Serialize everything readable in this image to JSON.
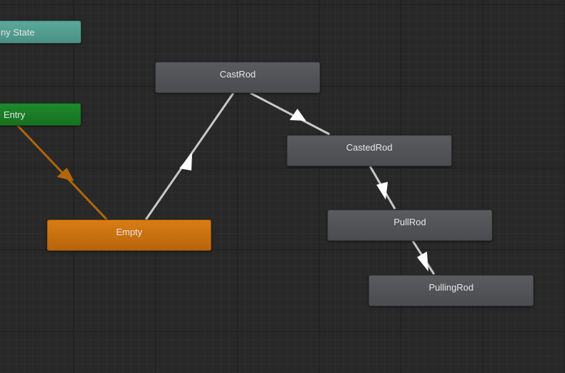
{
  "graph": {
    "background_color": "#282828",
    "states": {
      "any_state": {
        "label": "ny State",
        "color": "#5ba89a"
      },
      "entry": {
        "label": "Entry",
        "color": "#1e8a2e"
      },
      "empty": {
        "label": "Empty",
        "color": "#d97d14",
        "is_default": true
      },
      "cast_rod": {
        "label": "CastRod",
        "color": "#55565a"
      },
      "casted_rod": {
        "label": "CastedRod",
        "color": "#55565a"
      },
      "pull_rod": {
        "label": "PullRod",
        "color": "#55565a"
      },
      "pulling_rod": {
        "label": "PullingRod",
        "color": "#55565a"
      }
    },
    "transitions": [
      {
        "from": "Entry",
        "to": "Empty",
        "color": "#b0670a"
      },
      {
        "from": "Empty",
        "to": "CastRod",
        "color": "#c8c8c8"
      },
      {
        "from": "CastRod",
        "to": "CastedRod",
        "color": "#c8c8c8"
      },
      {
        "from": "CastedRod",
        "to": "PullRod",
        "color": "#c8c8c8"
      },
      {
        "from": "PullRod",
        "to": "PullingRod",
        "color": "#c8c8c8"
      }
    ]
  }
}
